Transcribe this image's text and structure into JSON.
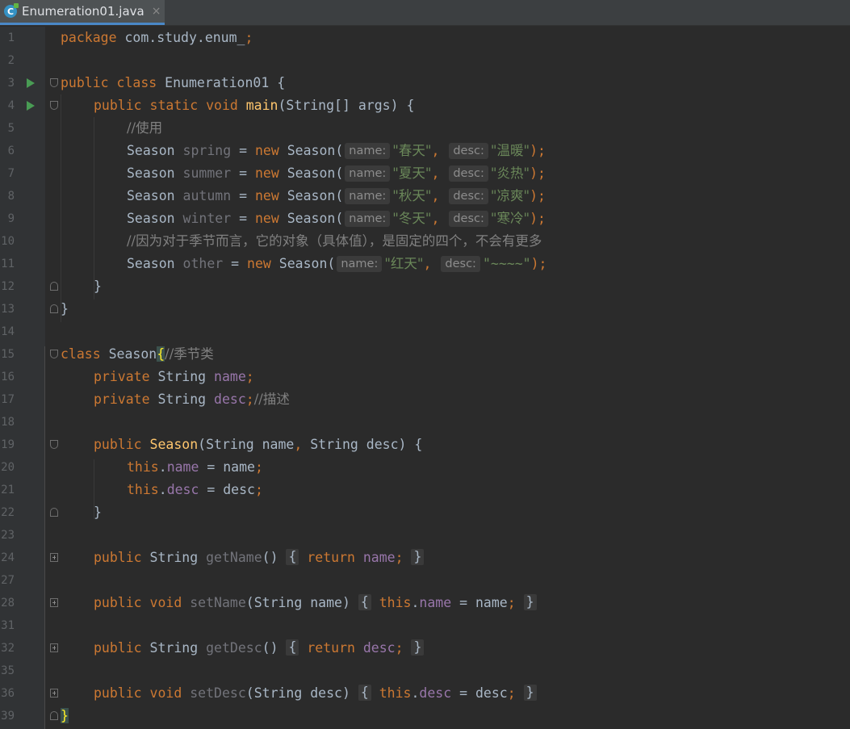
{
  "tab": {
    "title": "Enumeration01.java",
    "close": "×"
  },
  "lines": [
    {
      "n": "1"
    },
    {
      "n": "2"
    },
    {
      "n": "3"
    },
    {
      "n": "4"
    },
    {
      "n": "5"
    },
    {
      "n": "6"
    },
    {
      "n": "7"
    },
    {
      "n": "8"
    },
    {
      "n": "9"
    },
    {
      "n": "10"
    },
    {
      "n": "11"
    },
    {
      "n": "12"
    },
    {
      "n": "13"
    },
    {
      "n": "14"
    },
    {
      "n": "15"
    },
    {
      "n": "16"
    },
    {
      "n": "17"
    },
    {
      "n": "18"
    },
    {
      "n": "19"
    },
    {
      "n": "20"
    },
    {
      "n": "21"
    },
    {
      "n": "22"
    },
    {
      "n": "23"
    },
    {
      "n": "24"
    },
    {
      "n": "27"
    },
    {
      "n": "28"
    },
    {
      "n": "31"
    },
    {
      "n": "32"
    },
    {
      "n": "35"
    },
    {
      "n": "36"
    },
    {
      "n": "39"
    }
  ],
  "code": {
    "l1": {
      "kw": "package",
      "rest": " com.study.enum_",
      "semi": ";"
    },
    "l3": {
      "kw": "public class",
      "name": " Enumeration01 {"
    },
    "l4": {
      "kw": "public static void",
      "fn": "main",
      "rest": "(String[] args) {"
    },
    "l5": {
      "comment": "//使用"
    },
    "seasons": [
      {
        "type": "Season ",
        "var": "spring",
        "eq": " = ",
        "kw": "new",
        "ctor": " Season(",
        "h1": "name:",
        "s1": "\"春天\"",
        "comma": ",",
        "h2": "desc:",
        "s2": "\"温暖\"",
        "end": ");"
      },
      {
        "type": "Season ",
        "var": "summer",
        "eq": " = ",
        "kw": "new",
        "ctor": " Season(",
        "h1": "name:",
        "s1": "\"夏天\"",
        "comma": ",",
        "h2": "desc:",
        "s2": "\"炎热\"",
        "end": ");"
      },
      {
        "type": "Season ",
        "var": "autumn",
        "eq": " = ",
        "kw": "new",
        "ctor": " Season(",
        "h1": "name:",
        "s1": "\"秋天\"",
        "comma": ",",
        "h2": "desc:",
        "s2": "\"凉爽\"",
        "end": ");"
      },
      {
        "type": "Season ",
        "var": "winter",
        "eq": " = ",
        "kw": "new",
        "ctor": " Season(",
        "h1": "name:",
        "s1": "\"冬天\"",
        "comma": ",",
        "h2": "desc:",
        "s2": "\"寒冷\"",
        "end": ");"
      }
    ],
    "l10": {
      "comment": "//因为对于季节而言，它的对象（具体值），是固定的四个，不会有更多"
    },
    "l11": {
      "type": "Season ",
      "var": "other",
      "eq": " = ",
      "kw": "new",
      "ctor": " Season(",
      "h1": "name:",
      "s1": "\"红天\"",
      "comma": ",",
      "h2": "desc:",
      "s2": "\"~~~~\"",
      "end": ");"
    },
    "l12": {
      "text": "}"
    },
    "l13": {
      "text": "}"
    },
    "l15": {
      "kw": "class",
      "name": " Season",
      "brace": "{",
      "comment": "//季节类"
    },
    "l16": {
      "kw": "private",
      "type": " String ",
      "field": "name",
      "semi": ";"
    },
    "l17": {
      "kw": "private",
      "type": " String ",
      "field": "desc",
      "semi": ";",
      "comment": "//描述"
    },
    "l19": {
      "kw": "public",
      "fn": " Season",
      "p1": "(String name",
      "comma": ",",
      "p2": " String desc) {"
    },
    "l20": {
      "kw": "this",
      "dot": ".",
      "field": "name",
      "rest": " = name",
      "semi": ";"
    },
    "l21": {
      "kw": "this",
      "dot": ".",
      "field": "desc",
      "rest": " = desc",
      "semi": ";"
    },
    "l22": {
      "text": "}"
    },
    "l24": {
      "kw": "public",
      "type": " String ",
      "method": "getName",
      "paren": "()",
      "ob": "{",
      "kw2": "return",
      "field": " name",
      "semi": ";",
      "cb": "}"
    },
    "l28": {
      "kw": "public void",
      "method": " setName",
      "params": "(String name)",
      "ob": "{",
      "kw2": "this",
      "dot": ".",
      "field": "name",
      "rest": " = name",
      "semi": ";",
      "cb": "}"
    },
    "l32": {
      "kw": "public",
      "type": " String ",
      "method": "getDesc",
      "paren": "()",
      "ob": "{",
      "kw2": "return",
      "field": " desc",
      "semi": ";",
      "cb": "}"
    },
    "l36": {
      "kw": "public void",
      "method": " setDesc",
      "params": "(String desc)",
      "ob": "{",
      "kw2": "this",
      "dot": ".",
      "field": "desc",
      "rest": " = desc",
      "semi": ";",
      "cb": "}"
    },
    "l39": {
      "text": "}"
    }
  }
}
